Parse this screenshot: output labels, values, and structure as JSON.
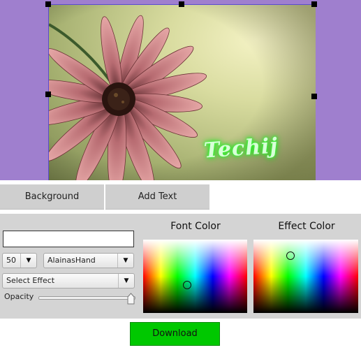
{
  "canvas": {
    "watermark_text": "Techij",
    "background_color": "#9f7fce",
    "image_subject": "pink daisy flower photo"
  },
  "tabs": {
    "background_label": "Background",
    "add_text_label": "Add Text"
  },
  "text_panel": {
    "text_value": "",
    "font_size": "50",
    "font_name": "AlainasHand",
    "effect": "Select Effect",
    "opacity_label": "Opacity",
    "opacity_value": 1.0
  },
  "color_pickers": {
    "font_color_label": "Font Color",
    "effect_color_label": "Effect Color"
  },
  "download_label": "Download",
  "colors": {
    "panel": "#d4d4d4",
    "tab": "#cfcfcf",
    "download": "#00c800",
    "selection_border": "#5a4bd0"
  }
}
